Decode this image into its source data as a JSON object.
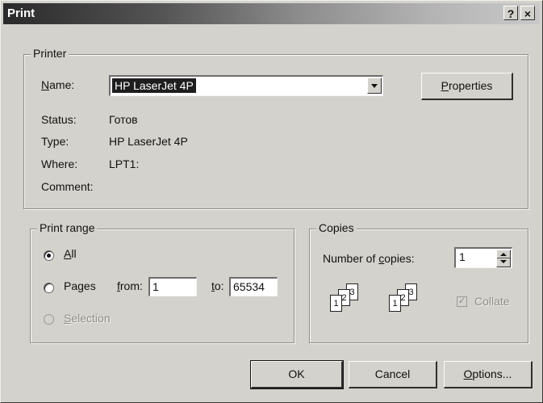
{
  "window": {
    "title": "Print",
    "help_button": "?",
    "close_button": "×"
  },
  "printer_group": {
    "label": "Printer",
    "name_label": "Name:",
    "name_value": "HP LaserJet 4P",
    "properties_button": "Properties",
    "status_label": "Status:",
    "status_value": "Готов",
    "type_label": "Type:",
    "type_value": "HP LaserJet 4P",
    "where_label": "Where:",
    "where_value": "LPT1:",
    "comment_label": "Comment:",
    "comment_value": ""
  },
  "print_range": {
    "label": "Print range",
    "all_label": "All",
    "pages_label": "Pages",
    "from_label": "from:",
    "from_value": "1",
    "to_label": "to:",
    "to_value": "65534",
    "selection_label": "Selection",
    "selected": "all"
  },
  "copies": {
    "label": "Copies",
    "number_label": "Number of copies:",
    "number_value": "1",
    "collate_label": "Collate",
    "collate_checked": true,
    "collate_check_glyph": "✓",
    "stack_a": [
      "1",
      "2",
      "3"
    ],
    "stack_b": [
      "1",
      "2",
      "3"
    ]
  },
  "buttons": {
    "ok": "OK",
    "cancel": "Cancel",
    "options": "Options..."
  }
}
